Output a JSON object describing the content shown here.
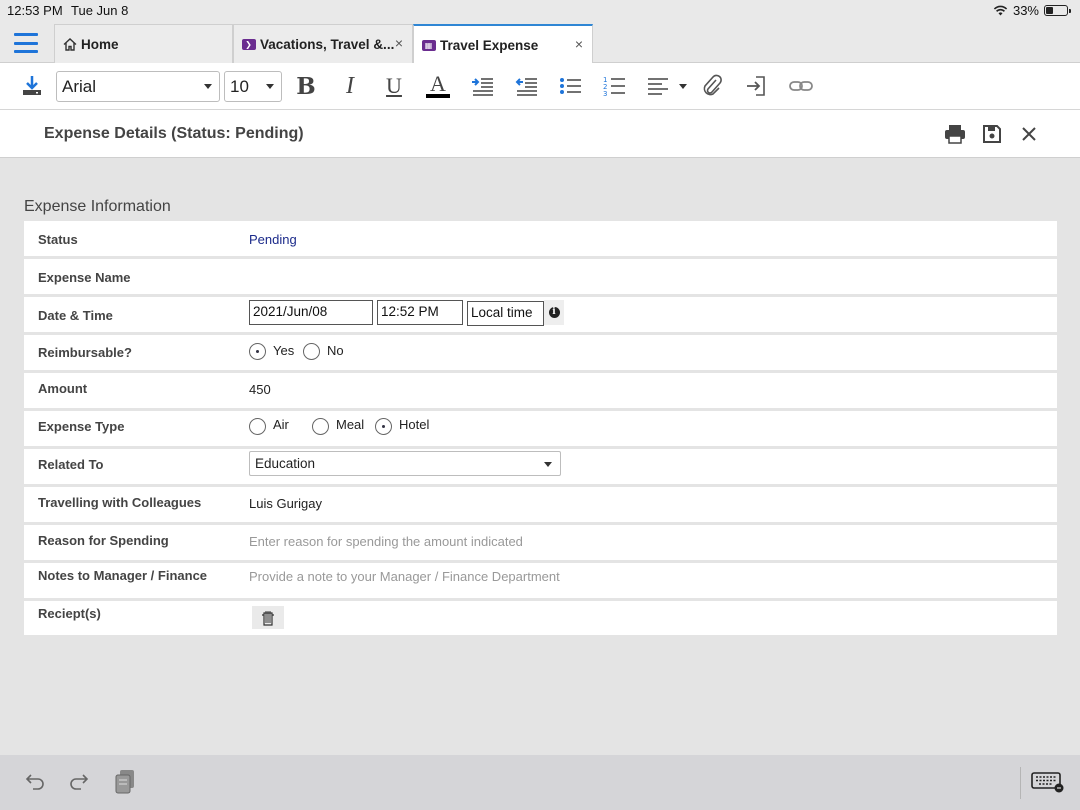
{
  "status_bar": {
    "time": "12:53 PM",
    "date": "Tue Jun 8",
    "battery_percent": "33%",
    "battery_level": 0.33
  },
  "tabs": [
    {
      "label": "Home",
      "icon": "home-icon",
      "active": false
    },
    {
      "label": "Vacations, Travel &...",
      "icon": "app-icon",
      "active": false,
      "close": "×"
    },
    {
      "label": "Travel Expense",
      "icon": "app-icon",
      "active": true,
      "close": "×"
    }
  ],
  "toolbar": {
    "font_family": "Arial",
    "font_size": "10",
    "bold": "B",
    "italic": "I",
    "underline": "U",
    "text_color": "A",
    "text_color_value": "#000000"
  },
  "header": {
    "title": "Expense Details (Status: Pending)"
  },
  "form": {
    "section_title": "Expense Information",
    "status": {
      "label": "Status",
      "value": "Pending"
    },
    "expense_name": {
      "label": "Expense Name",
      "value": ""
    },
    "date_time": {
      "label": "Date & Time",
      "date": "2021/Jun/08",
      "time": "12:52 PM",
      "timezone": "Local time"
    },
    "reimbursable": {
      "label": "Reimbursable?",
      "options": [
        "Yes",
        "No"
      ],
      "selected": "Yes"
    },
    "amount": {
      "label": "Amount",
      "value": "450"
    },
    "expense_type": {
      "label": "Expense Type",
      "options": [
        "Air",
        "Meal",
        "Hotel"
      ],
      "selected": "Hotel"
    },
    "related_to": {
      "label": "Related To",
      "value": "Education"
    },
    "colleagues": {
      "label": "Travelling with Colleagues",
      "value": "Luis Gurigay"
    },
    "reason": {
      "label": "Reason for Spending",
      "placeholder": "Enter reason for spending the amount indicated"
    },
    "notes": {
      "label": "Notes to Manager / Finance",
      "placeholder": "Provide a note to your Manager / Finance Department"
    },
    "receipts": {
      "label": "Reciept(s)"
    }
  },
  "colors": {
    "accent": "#1e74d9",
    "status_text": "#1b2a8a",
    "app_icon": "#6a2c8f"
  }
}
